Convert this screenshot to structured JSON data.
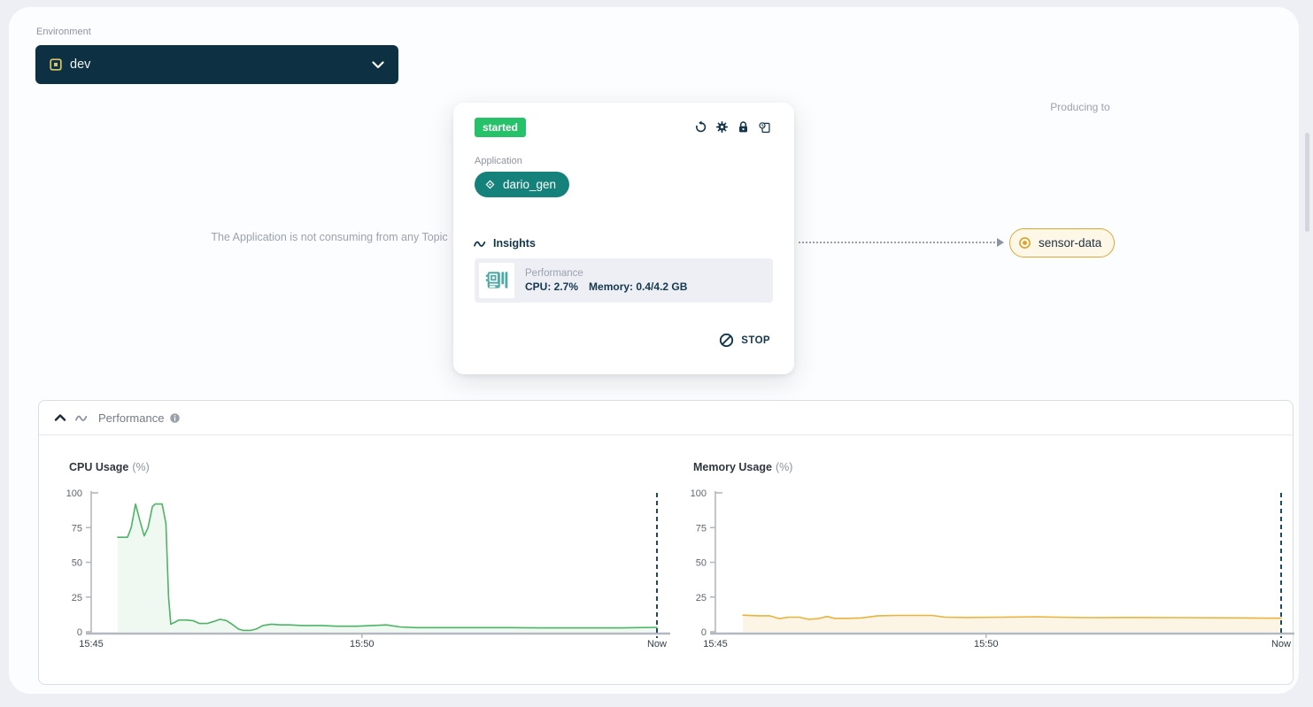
{
  "environment": {
    "label": "Environment",
    "selected": "dev"
  },
  "card": {
    "status": "started",
    "application_label": "Application",
    "application_name": "dario_gen",
    "insights_label": "Insights",
    "insight_title": "Performance",
    "insight_cpu": "CPU: 2.7%",
    "insight_memory": "Memory: 0.4/4.2 GB",
    "stop_label": "STOP",
    "action_icons": [
      "redeploy-icon",
      "settings-icon",
      "lock-icon",
      "logs-icon"
    ]
  },
  "pipeline": {
    "no_input_text": "The Application is not consuming from any Topic",
    "producing_to_label": "Producing to",
    "output_topic": "sensor-data"
  },
  "panel": {
    "title": "Performance"
  },
  "colors": {
    "status_green": "#27c169",
    "app_teal": "#15817b",
    "topic_amber": "#dfa72f",
    "navy": "#14374d",
    "env_dark": "#0d3142",
    "cpu_line": "#4cb464",
    "memory_line": "#e9b33c"
  },
  "chart_data": [
    {
      "type": "area",
      "title": "CPU Usage",
      "unit": "(%)",
      "ylim": [
        0,
        100
      ],
      "yticks": [
        0,
        25,
        50,
        75,
        100
      ],
      "xticks": [
        {
          "t": 0,
          "label": "15:45"
        },
        {
          "t": 5,
          "label": "15:50"
        },
        {
          "t": 10.45,
          "label": "Now"
        }
      ],
      "t_max": 10.45,
      "now_t": 10.45,
      "line_color": "#4cb464",
      "fill_color": "rgba(76,180,100,0.09)",
      "points": [
        [
          0.49,
          68
        ],
        [
          0.67,
          68
        ],
        [
          0.74,
          75
        ],
        [
          0.82,
          92
        ],
        [
          0.9,
          80
        ],
        [
          0.98,
          69
        ],
        [
          1.05,
          75
        ],
        [
          1.13,
          90
        ],
        [
          1.18,
          92
        ],
        [
          1.31,
          92
        ],
        [
          1.38,
          78
        ],
        [
          1.43,
          25
        ],
        [
          1.47,
          5.5
        ],
        [
          1.55,
          7
        ],
        [
          1.62,
          8.5
        ],
        [
          1.75,
          8.5
        ],
        [
          1.88,
          8
        ],
        [
          2.0,
          6
        ],
        [
          2.14,
          6
        ],
        [
          2.27,
          7.5
        ],
        [
          2.38,
          9
        ],
        [
          2.5,
          8
        ],
        [
          2.62,
          5
        ],
        [
          2.72,
          2
        ],
        [
          2.8,
          1
        ],
        [
          2.95,
          1
        ],
        [
          3.05,
          2
        ],
        [
          3.17,
          4.5
        ],
        [
          3.33,
          5.5
        ],
        [
          3.5,
          5
        ],
        [
          3.66,
          5
        ],
        [
          3.9,
          4.5
        ],
        [
          4.25,
          4.5
        ],
        [
          4.55,
          4
        ],
        [
          4.9,
          4
        ],
        [
          5.2,
          4.5
        ],
        [
          5.45,
          5
        ],
        [
          5.7,
          3.5
        ],
        [
          6.0,
          3
        ],
        [
          6.5,
          3
        ],
        [
          7.0,
          3
        ],
        [
          7.7,
          3
        ],
        [
          8.3,
          2.8
        ],
        [
          9.1,
          2.8
        ],
        [
          9.8,
          2.8
        ],
        [
          10.45,
          3.2
        ]
      ]
    },
    {
      "type": "area",
      "title": "Memory Usage",
      "unit": "(%)",
      "ylim": [
        0,
        100
      ],
      "yticks": [
        0,
        25,
        50,
        75,
        100
      ],
      "xticks": [
        {
          "t": 0,
          "label": "15:45"
        },
        {
          "t": 5,
          "label": "15:50"
        },
        {
          "t": 10.45,
          "label": "Now"
        }
      ],
      "t_max": 10.45,
      "now_t": 10.45,
      "line_color": "#e9b33c",
      "fill_color": "rgba(233,179,60,0.13)",
      "points": [
        [
          0.51,
          12
        ],
        [
          0.8,
          11.5
        ],
        [
          1.0,
          11.5
        ],
        [
          1.18,
          9.5
        ],
        [
          1.35,
          10.5
        ],
        [
          1.55,
          10.5
        ],
        [
          1.72,
          9
        ],
        [
          1.9,
          9.5
        ],
        [
          2.06,
          11
        ],
        [
          2.2,
          9.7
        ],
        [
          2.45,
          9.7
        ],
        [
          2.7,
          10
        ],
        [
          3.0,
          11.5
        ],
        [
          3.35,
          11.8
        ],
        [
          4.0,
          11.8
        ],
        [
          4.25,
          10.5
        ],
        [
          4.65,
          10.3
        ],
        [
          5.3,
          10.5
        ],
        [
          5.95,
          10.8
        ],
        [
          6.3,
          10.5
        ],
        [
          6.95,
          10.2
        ],
        [
          7.6,
          10.3
        ],
        [
          8.6,
          10.2
        ],
        [
          9.55,
          10
        ],
        [
          10.2,
          9.8
        ],
        [
          10.45,
          9.8
        ]
      ]
    }
  ]
}
